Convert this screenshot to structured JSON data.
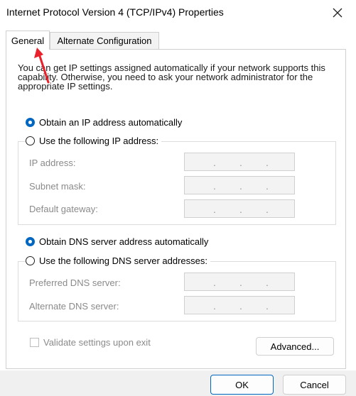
{
  "window": {
    "title": "Internet Protocol Version 4 (TCP/IPv4) Properties",
    "close_icon": "close-icon"
  },
  "tabs": [
    {
      "label": "General",
      "active": true
    },
    {
      "label": "Alternate Configuration",
      "active": false
    }
  ],
  "description": "You can get IP settings assigned automatically if your network supports this capability. Otherwise, you need to ask your network administrator for the appropriate IP settings.",
  "ip": {
    "auto_label": "Obtain an IP address automatically",
    "manual_label": "Use the following IP address:",
    "auto_selected": true,
    "fields": [
      {
        "label": "IP address:",
        "value": ". . ."
      },
      {
        "label": "Subnet mask:",
        "value": ". . ."
      },
      {
        "label": "Default gateway:",
        "value": ". . ."
      }
    ]
  },
  "dns": {
    "auto_label": "Obtain DNS server address automatically",
    "manual_label": "Use the following DNS server addresses:",
    "auto_selected": true,
    "fields": [
      {
        "label": "Preferred DNS server:",
        "value": ". . ."
      },
      {
        "label": "Alternate DNS server:",
        "value": ". . ."
      }
    ]
  },
  "validate": {
    "label": "Validate settings upon exit",
    "checked": false,
    "enabled": false
  },
  "buttons": {
    "advanced": "Advanced...",
    "ok": "OK",
    "cancel": "Cancel"
  },
  "colors": {
    "accent": "#0067c0",
    "annotation_arrow": "#e8212a",
    "disabled_text": "#8a8a8a"
  }
}
